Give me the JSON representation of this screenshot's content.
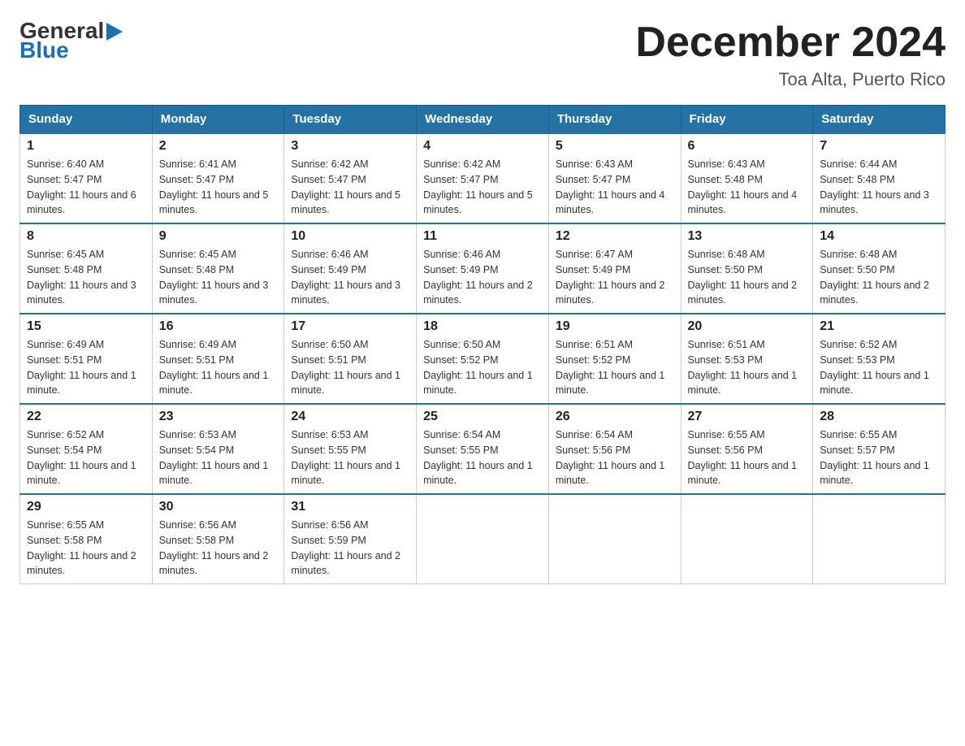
{
  "header": {
    "logo_general": "General",
    "logo_blue": "Blue",
    "month_title": "December 2024",
    "location": "Toa Alta, Puerto Rico"
  },
  "days_of_week": [
    "Sunday",
    "Monday",
    "Tuesday",
    "Wednesday",
    "Thursday",
    "Friday",
    "Saturday"
  ],
  "weeks": [
    [
      {
        "day": "1",
        "sunrise": "Sunrise: 6:40 AM",
        "sunset": "Sunset: 5:47 PM",
        "daylight": "Daylight: 11 hours and 6 minutes."
      },
      {
        "day": "2",
        "sunrise": "Sunrise: 6:41 AM",
        "sunset": "Sunset: 5:47 PM",
        "daylight": "Daylight: 11 hours and 5 minutes."
      },
      {
        "day": "3",
        "sunrise": "Sunrise: 6:42 AM",
        "sunset": "Sunset: 5:47 PM",
        "daylight": "Daylight: 11 hours and 5 minutes."
      },
      {
        "day": "4",
        "sunrise": "Sunrise: 6:42 AM",
        "sunset": "Sunset: 5:47 PM",
        "daylight": "Daylight: 11 hours and 5 minutes."
      },
      {
        "day": "5",
        "sunrise": "Sunrise: 6:43 AM",
        "sunset": "Sunset: 5:47 PM",
        "daylight": "Daylight: 11 hours and 4 minutes."
      },
      {
        "day": "6",
        "sunrise": "Sunrise: 6:43 AM",
        "sunset": "Sunset: 5:48 PM",
        "daylight": "Daylight: 11 hours and 4 minutes."
      },
      {
        "day": "7",
        "sunrise": "Sunrise: 6:44 AM",
        "sunset": "Sunset: 5:48 PM",
        "daylight": "Daylight: 11 hours and 3 minutes."
      }
    ],
    [
      {
        "day": "8",
        "sunrise": "Sunrise: 6:45 AM",
        "sunset": "Sunset: 5:48 PM",
        "daylight": "Daylight: 11 hours and 3 minutes."
      },
      {
        "day": "9",
        "sunrise": "Sunrise: 6:45 AM",
        "sunset": "Sunset: 5:48 PM",
        "daylight": "Daylight: 11 hours and 3 minutes."
      },
      {
        "day": "10",
        "sunrise": "Sunrise: 6:46 AM",
        "sunset": "Sunset: 5:49 PM",
        "daylight": "Daylight: 11 hours and 3 minutes."
      },
      {
        "day": "11",
        "sunrise": "Sunrise: 6:46 AM",
        "sunset": "Sunset: 5:49 PM",
        "daylight": "Daylight: 11 hours and 2 minutes."
      },
      {
        "day": "12",
        "sunrise": "Sunrise: 6:47 AM",
        "sunset": "Sunset: 5:49 PM",
        "daylight": "Daylight: 11 hours and 2 minutes."
      },
      {
        "day": "13",
        "sunrise": "Sunrise: 6:48 AM",
        "sunset": "Sunset: 5:50 PM",
        "daylight": "Daylight: 11 hours and 2 minutes."
      },
      {
        "day": "14",
        "sunrise": "Sunrise: 6:48 AM",
        "sunset": "Sunset: 5:50 PM",
        "daylight": "Daylight: 11 hours and 2 minutes."
      }
    ],
    [
      {
        "day": "15",
        "sunrise": "Sunrise: 6:49 AM",
        "sunset": "Sunset: 5:51 PM",
        "daylight": "Daylight: 11 hours and 1 minute."
      },
      {
        "day": "16",
        "sunrise": "Sunrise: 6:49 AM",
        "sunset": "Sunset: 5:51 PM",
        "daylight": "Daylight: 11 hours and 1 minute."
      },
      {
        "day": "17",
        "sunrise": "Sunrise: 6:50 AM",
        "sunset": "Sunset: 5:51 PM",
        "daylight": "Daylight: 11 hours and 1 minute."
      },
      {
        "day": "18",
        "sunrise": "Sunrise: 6:50 AM",
        "sunset": "Sunset: 5:52 PM",
        "daylight": "Daylight: 11 hours and 1 minute."
      },
      {
        "day": "19",
        "sunrise": "Sunrise: 6:51 AM",
        "sunset": "Sunset: 5:52 PM",
        "daylight": "Daylight: 11 hours and 1 minute."
      },
      {
        "day": "20",
        "sunrise": "Sunrise: 6:51 AM",
        "sunset": "Sunset: 5:53 PM",
        "daylight": "Daylight: 11 hours and 1 minute."
      },
      {
        "day": "21",
        "sunrise": "Sunrise: 6:52 AM",
        "sunset": "Sunset: 5:53 PM",
        "daylight": "Daylight: 11 hours and 1 minute."
      }
    ],
    [
      {
        "day": "22",
        "sunrise": "Sunrise: 6:52 AM",
        "sunset": "Sunset: 5:54 PM",
        "daylight": "Daylight: 11 hours and 1 minute."
      },
      {
        "day": "23",
        "sunrise": "Sunrise: 6:53 AM",
        "sunset": "Sunset: 5:54 PM",
        "daylight": "Daylight: 11 hours and 1 minute."
      },
      {
        "day": "24",
        "sunrise": "Sunrise: 6:53 AM",
        "sunset": "Sunset: 5:55 PM",
        "daylight": "Daylight: 11 hours and 1 minute."
      },
      {
        "day": "25",
        "sunrise": "Sunrise: 6:54 AM",
        "sunset": "Sunset: 5:55 PM",
        "daylight": "Daylight: 11 hours and 1 minute."
      },
      {
        "day": "26",
        "sunrise": "Sunrise: 6:54 AM",
        "sunset": "Sunset: 5:56 PM",
        "daylight": "Daylight: 11 hours and 1 minute."
      },
      {
        "day": "27",
        "sunrise": "Sunrise: 6:55 AM",
        "sunset": "Sunset: 5:56 PM",
        "daylight": "Daylight: 11 hours and 1 minute."
      },
      {
        "day": "28",
        "sunrise": "Sunrise: 6:55 AM",
        "sunset": "Sunset: 5:57 PM",
        "daylight": "Daylight: 11 hours and 1 minute."
      }
    ],
    [
      {
        "day": "29",
        "sunrise": "Sunrise: 6:55 AM",
        "sunset": "Sunset: 5:58 PM",
        "daylight": "Daylight: 11 hours and 2 minutes."
      },
      {
        "day": "30",
        "sunrise": "Sunrise: 6:56 AM",
        "sunset": "Sunset: 5:58 PM",
        "daylight": "Daylight: 11 hours and 2 minutes."
      },
      {
        "day": "31",
        "sunrise": "Sunrise: 6:56 AM",
        "sunset": "Sunset: 5:59 PM",
        "daylight": "Daylight: 11 hours and 2 minutes."
      },
      null,
      null,
      null,
      null
    ]
  ]
}
